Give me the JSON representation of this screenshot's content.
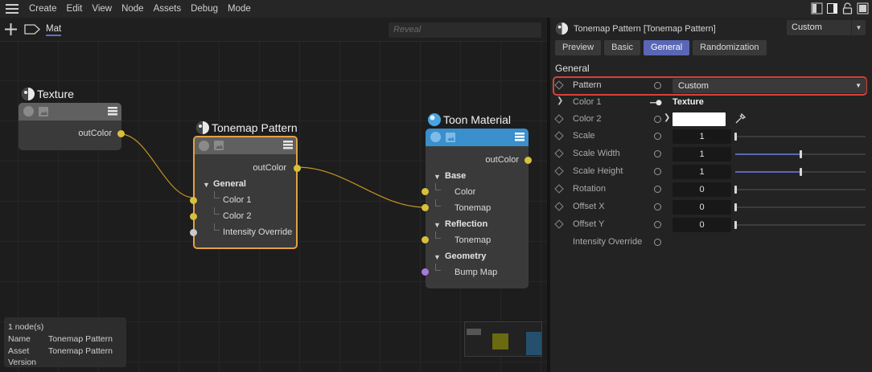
{
  "menubar": {
    "items": [
      "Create",
      "Edit",
      "View",
      "Node",
      "Assets",
      "Debug",
      "Mode"
    ],
    "icons": [
      "hamburger-menu-icon",
      "layout-left-icon",
      "layout-right-icon",
      "lock-icon",
      "hide-icon"
    ]
  },
  "editor": {
    "tab_label": "Mat",
    "search_placeholder": "Reveal",
    "nodes": {
      "texture": {
        "title": "Texture",
        "outputs": [
          "outColor"
        ]
      },
      "tonemap": {
        "title": "Tonemap Pattern",
        "output": "outColor",
        "group": "General",
        "inputs": [
          "Color 1",
          "Color 2",
          "Intensity Override"
        ]
      },
      "toon": {
        "title": "Toon Material",
        "output": "outColor",
        "groups": [
          {
            "name": "Base",
            "inputs": [
              "Color",
              "Tonemap"
            ]
          },
          {
            "name": "Reflection",
            "inputs": [
              "Tonemap"
            ]
          },
          {
            "name": "Geometry",
            "inputs": [
              "Bump Map"
            ]
          }
        ]
      }
    },
    "info": {
      "count": "1 node(s)",
      "rows": [
        {
          "label": "Name",
          "value": "Tonemap Pattern"
        },
        {
          "label": "Asset",
          "value": "Tonemap Pattern"
        },
        {
          "label": "Version",
          "value": ""
        }
      ]
    }
  },
  "panel": {
    "title": "Tonemap Pattern [Tonemap Pattern]",
    "mode": "Custom",
    "tabs": [
      "Preview",
      "Basic",
      "General",
      "Randomization"
    ],
    "active_tab": "General",
    "section": "General",
    "properties": {
      "pattern": {
        "label": "Pattern",
        "value": "Custom"
      },
      "color1": {
        "label": "Color 1",
        "value": "Texture"
      },
      "color2": {
        "label": "Color 2",
        "swatch": "#ffffff"
      },
      "scale": {
        "label": "Scale",
        "value": "1",
        "level": 0
      },
      "scale_width": {
        "label": "Scale Width",
        "value": "1",
        "level": 0.5
      },
      "scale_height": {
        "label": "Scale Height",
        "value": "1",
        "level": 0.5
      },
      "rotation": {
        "label": "Rotation",
        "value": "0",
        "level": 0
      },
      "offset_x": {
        "label": "Offset X",
        "value": "0",
        "level": 0
      },
      "offset_y": {
        "label": "Offset Y",
        "value": "0",
        "level": 0
      },
      "intensity_override": {
        "label": "Intensity Override"
      }
    }
  },
  "colors": {
    "accent": "#5a67b6",
    "port": "#d8c03a",
    "toon_header": "#3a8fcc",
    "selected_border": "#e3a147",
    "highlight": "#d8403a"
  }
}
